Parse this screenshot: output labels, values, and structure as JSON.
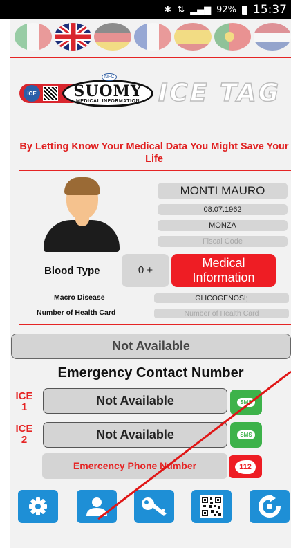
{
  "statusbar": {
    "icons": [
      "bluetooth-icon",
      "data-signal-icon",
      "signal-bars-icon"
    ],
    "battery": "92%",
    "time": "15:37"
  },
  "languages": [
    {
      "name": "italian-flag-icon",
      "active": false
    },
    {
      "name": "uk-flag-icon",
      "active": true
    },
    {
      "name": "german-flag-icon",
      "active": false
    },
    {
      "name": "french-flag-icon",
      "active": false
    },
    {
      "name": "spanish-flag-icon",
      "active": false
    },
    {
      "name": "portuguese-flag-icon",
      "active": false
    },
    {
      "name": "dutch-flag-icon",
      "active": false
    }
  ],
  "logo": {
    "ice_badge": "ICE",
    "nfc": "NFC",
    "brand": "SUOMY",
    "brand_sub": "MEDICAL INFORMATION",
    "product": "ICE TAG"
  },
  "slogan": "By Letting Know Your Medical Data You Might Save Your Life",
  "profile": {
    "name": "MONTI MAURO",
    "birthdate": "08.07.1962",
    "city": "MONZA",
    "fiscal_code_placeholder": "Fiscal Code"
  },
  "blood": {
    "label": "Blood Type",
    "value": "0 +",
    "medical_button": "Medical Information"
  },
  "macro_disease": {
    "label": "Macro Disease",
    "value": "GLICOGENOSI;"
  },
  "health_card": {
    "label": "Number of Health Card",
    "placeholder": "Number of Health Card"
  },
  "not_available_main": "Not Available",
  "emergency": {
    "title": "Emergency Contact Number",
    "contacts": [
      {
        "label_top": "ICE",
        "label_num": "1",
        "value": "Not Available",
        "sms": "SMS"
      },
      {
        "label_top": "ICE",
        "label_num": "2",
        "value": "Not Available",
        "sms": "SMS"
      }
    ],
    "phone_label": "Emercency Phone Number",
    "phone_button": "112"
  },
  "bottom_nav": [
    "settings-icon",
    "profile-icon",
    "key-icon",
    "qr-code-icon",
    "refresh-icon"
  ],
  "colors": {
    "accent_red": "#ee1d24",
    "nav_blue": "#1e8fd6",
    "sms_green": "#3db24a",
    "field_gray": "#d6d6d6"
  }
}
